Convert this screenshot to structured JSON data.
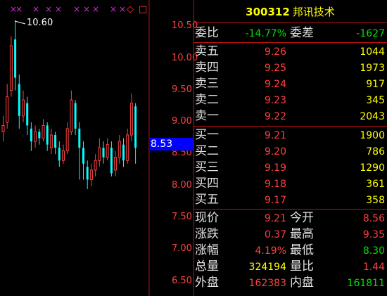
{
  "header": {
    "code": "300312",
    "name": "邦讯技术"
  },
  "stats_top": {
    "weibi_label": "委比",
    "weibi_value": "-14.77%",
    "weicha_label": "委差",
    "weicha_value": "-1627"
  },
  "sell": [
    {
      "label": "卖五",
      "price": "9.26",
      "volume": "1044"
    },
    {
      "label": "卖四",
      "price": "9.25",
      "volume": "1973"
    },
    {
      "label": "卖三",
      "price": "9.24",
      "volume": "917"
    },
    {
      "label": "卖二",
      "price": "9.23",
      "volume": "345"
    },
    {
      "label": "卖一",
      "price": "9.22",
      "volume": "2043"
    }
  ],
  "buy": [
    {
      "label": "买一",
      "price": "9.21",
      "volume": "1900"
    },
    {
      "label": "买二",
      "price": "9.20",
      "volume": "786"
    },
    {
      "label": "买三",
      "price": "9.19",
      "volume": "1290"
    },
    {
      "label": "买四",
      "price": "9.18",
      "volume": "361"
    },
    {
      "label": "买五",
      "price": "9.17",
      "volume": "358"
    }
  ],
  "quote": [
    {
      "l1": "现价",
      "v1": "9.21",
      "l2": "今开",
      "v2": "8.56"
    },
    {
      "l1": "涨跌",
      "v1": "0.37",
      "l2": "最高",
      "v2": "9.35"
    },
    {
      "l1": "涨幅",
      "v1": "4.19%",
      "l2": "最低",
      "v2": "8.30"
    },
    {
      "l1": "总量",
      "v1": "324194",
      "l2": "量比",
      "v2": "1.44"
    },
    {
      "l1": "外盘",
      "v1": "162383",
      "l2": "内盘",
      "v2": "161811"
    }
  ],
  "chart": {
    "current_price_tag": "8.53",
    "high_marker": "10.60",
    "y_ticks": [
      "10.50",
      "10.00",
      "9.50",
      "9.00",
      "8.50",
      "8.00",
      "7.50",
      "7.00",
      "6.50"
    ],
    "marks": [
      "×",
      "×",
      "×",
      "×",
      "×",
      "×",
      "×",
      "×",
      "×",
      "×"
    ],
    "icons": [
      "◇",
      "□"
    ]
  },
  "colors": {
    "up": "#ff4040",
    "down": "#00ffff",
    "grid": "#c01010"
  }
}
